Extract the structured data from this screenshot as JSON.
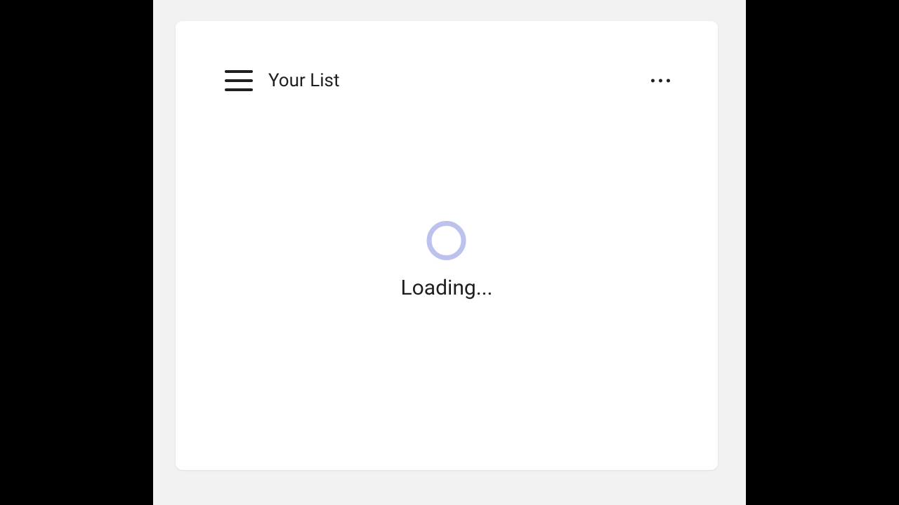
{
  "header": {
    "title": "Your List"
  },
  "content": {
    "loading_label": "Loading..."
  }
}
